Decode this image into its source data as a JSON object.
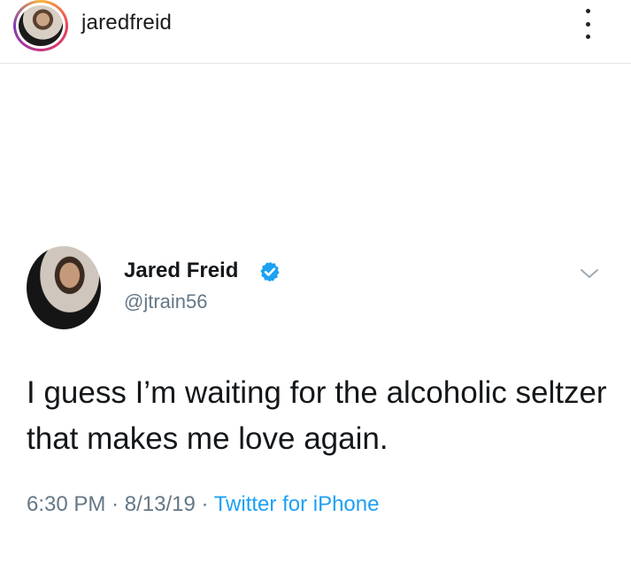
{
  "header": {
    "username": "jaredfreid",
    "more_icon": "more-vertical-icon"
  },
  "tweet": {
    "display_name": "Jared Freid",
    "verified_icon": "verified-badge-icon",
    "handle": "@jtrain56",
    "text": "I guess I’m waiting for the alcoholic seltzer that makes me love again.",
    "time": "6:30 PM",
    "separator": "·",
    "date": "8/13/19",
    "source": "Twitter for iPhone",
    "colors": {
      "verified": "#1da1f2",
      "link": "#1da1f2",
      "muted": "#657786"
    }
  }
}
